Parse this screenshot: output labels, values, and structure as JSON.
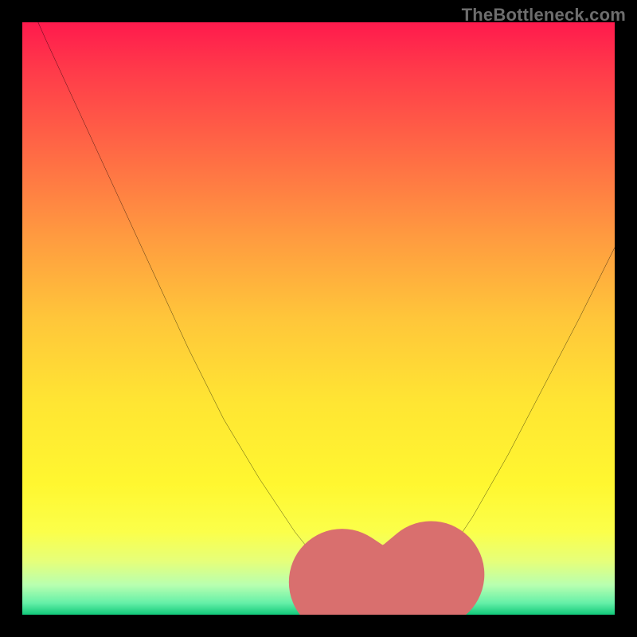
{
  "watermark": "TheBottleneck.com",
  "colors": {
    "page_bg": "#000000",
    "curve": "#000000",
    "marker": "#d96f6e",
    "gradient_top": "#ff1a4d",
    "gradient_bottom": "#12c97a"
  },
  "chart_data": {
    "type": "line",
    "title": "",
    "xlabel": "",
    "ylabel": "",
    "xlim": [
      0,
      100
    ],
    "ylim": [
      0,
      100
    ],
    "grid": false,
    "legend": false,
    "background": "vertical gradient red→yellow→green",
    "note": "Each point is plotted at (x%, y%) within the plot area; y measured from top. Higher plotted y = lower chart value.",
    "series": [
      {
        "name": "curve",
        "x": [
          0,
          4,
          10,
          16,
          22,
          28,
          34,
          40,
          46,
          50,
          54,
          57,
          58.5,
          60.5,
          63,
          66,
          69,
          72,
          76,
          82,
          88,
          94,
          100
        ],
        "y": [
          -6,
          3,
          16,
          29,
          42,
          55,
          67,
          77,
          86,
          91,
          94.5,
          96.5,
          97.5,
          97.5,
          97,
          95.5,
          93,
          89.5,
          83.5,
          73,
          61.5,
          50,
          38
        ]
      }
    ],
    "markers": {
      "name": "bottleneck-range-highlight",
      "color": "#d96f6e",
      "stroke_width_pct": 2.4,
      "points_x": [
        54,
        57,
        60,
        63,
        66,
        69
      ],
      "points_y": [
        94.5,
        96.5,
        97.5,
        97.2,
        95.7,
        93.2
      ]
    }
  }
}
